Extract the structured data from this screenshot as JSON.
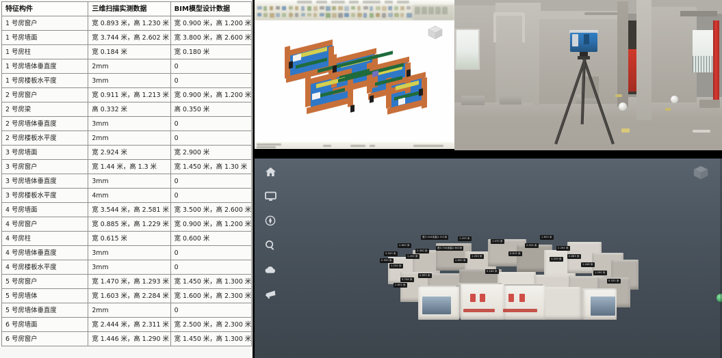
{
  "table": {
    "name": "comparison-table",
    "headers": [
      "特征构件",
      "三维扫描实测数据",
      "BIM模型设计数据"
    ],
    "rows": [
      [
        "1 号房窗户",
        "宽 0.893 米，高 1.230 米",
        "宽 0.900 米，高 1.200 米"
      ],
      [
        "1 号房墙面",
        "宽 3.744 米，高 2.602 米",
        "宽 3.800 米，高 2.600 米"
      ],
      [
        "1 号房柱",
        "宽 0.184 米",
        "宽 0.180 米"
      ],
      [
        "1 号房墙体垂直度",
        "2mm",
        "0"
      ],
      [
        "1 号房楼板水平度",
        "3mm",
        "0"
      ],
      [
        "2 号房窗户",
        "宽 0.911 米，高 1.213 米",
        "宽 0.900 米，高 1.200 米"
      ],
      [
        "2 号房梁",
        "高 0.332 米",
        "高 0.350 米"
      ],
      [
        "2 号房墙体垂直度",
        "3mm",
        "0"
      ],
      [
        "2 号房楼板水平度",
        "2mm",
        "0"
      ],
      [
        "3 号房墙面",
        "宽 2.924 米",
        "宽 2.900 米"
      ],
      [
        "3 号房窗户",
        "宽 1.44 米，高 1.3 米",
        "宽 1.450 米，高 1.30 米"
      ],
      [
        "3 号房墙体垂直度",
        "3mm",
        "0"
      ],
      [
        "3 号房楼板水平度",
        "4mm",
        "0"
      ],
      [
        "4 号房墙面",
        "宽 3.544 米，高 2.581 米",
        "宽 3.500 米，高 2.600 米"
      ],
      [
        "4 号房窗户",
        "宽 0.885 米，高 1.229 米",
        "宽 0.900 米，高 1.200 米"
      ],
      [
        "4 号房柱",
        "宽 0.615 米",
        "宽 0.600 米"
      ],
      [
        "4 号房墙体垂直度",
        "3mm",
        "0"
      ],
      [
        "4 号房楼板水平度",
        "3mm",
        "0"
      ],
      [
        "5 号房窗户",
        "宽 1.470 米，高 1.293 米",
        "宽 1.450 米，高 1.300 米"
      ],
      [
        "5 号房墙体",
        "宽 1.603 米，高 2.284 米",
        "宽 1.600 米，高 2.300 米"
      ],
      [
        "5 号房墙体垂直度",
        "2mm",
        "0"
      ],
      [
        "6 号房墙面",
        "宽 2.444 米，高 2.311 米",
        "宽 2.500 米，高 2.300 米"
      ],
      [
        "6 号房窗户",
        "宽 1.446 米，高 1.290 米",
        "宽 1.450 米，高 1.300 米"
      ]
    ]
  },
  "bim_panel": {
    "name": "bim-model-viewer",
    "description": "BIM 三维模型",
    "viewcube_icon": "view-cube-icon"
  },
  "photo_panel": {
    "name": "site-photo",
    "description": "三维激光扫描仪现场作业照片",
    "scanner_label": "3D laser scanner"
  },
  "pointcloud_panel": {
    "name": "point-cloud-viewer",
    "toolbar": [
      {
        "icon": "home-icon",
        "label": "首页"
      },
      {
        "icon": "monitor-icon",
        "label": "显示"
      },
      {
        "icon": "target-icon",
        "label": "定位"
      },
      {
        "icon": "search-icon",
        "label": "搜索"
      },
      {
        "icon": "cloud-icon",
        "label": "点云"
      },
      {
        "icon": "megaphone-icon",
        "label": "标注"
      }
    ],
    "viewcube_icon": "view-cube-icon",
    "marker_icon": "green-marker-icon",
    "annotations": [
      "3.500 米",
      "2.800 米",
      "1.450 米",
      "宽2.444米高2.311米",
      "2.300 米",
      "0.900 米",
      "1.230 米",
      "宽3.744米高2.602米",
      "2.600 米",
      "1.200 米",
      "0.893 米",
      "3.744 米",
      "2.602 米",
      "1.293 米",
      "1.470 米",
      "0.615 米",
      "2.924 米",
      "1.603 米",
      "2.284 米",
      "0.885 米",
      "1.229 米",
      "1.446 米",
      "1.290 米",
      "0.332 米",
      "0.184 米"
    ]
  }
}
